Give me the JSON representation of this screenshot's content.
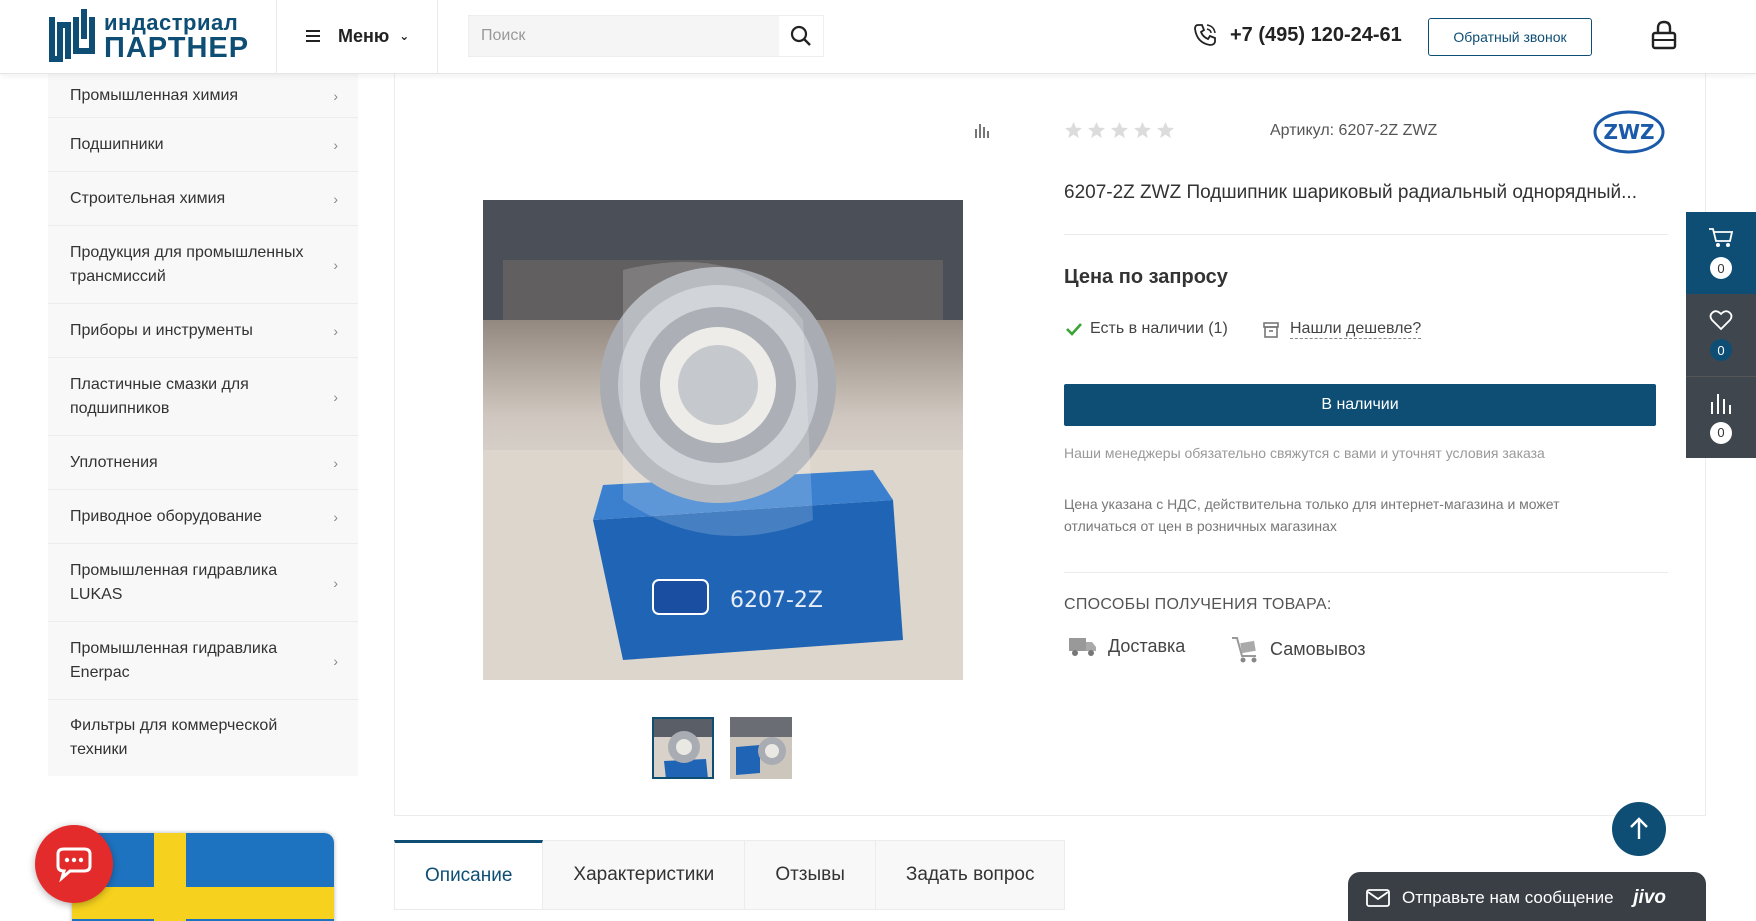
{
  "header": {
    "logo_line1": "индастриал",
    "logo_line2": "ПАРТНЕР",
    "menu_label": "Меню",
    "search_placeholder": "Поиск",
    "phone": "+7 (495) 120-24-61",
    "callback_label": "Обратный звонок"
  },
  "sidebar": {
    "items": [
      {
        "label": "Промышленная химия",
        "has_arrow": true
      },
      {
        "label": "Подшипники",
        "has_arrow": true
      },
      {
        "label": "Строительная химия",
        "has_arrow": true
      },
      {
        "label": "Продукция для промышленных трансмиссий",
        "has_arrow": true
      },
      {
        "label": "Приборы и инструменты",
        "has_arrow": true
      },
      {
        "label": "Пластичные смазки для подшипников",
        "has_arrow": true
      },
      {
        "label": "Уплотнения",
        "has_arrow": true
      },
      {
        "label": "Приводное оборудование",
        "has_arrow": true
      },
      {
        "label": "Промышленная гидравлика LUKAS",
        "has_arrow": true
      },
      {
        "label": "Промышленная гидравлика Enerpac",
        "has_arrow": true
      },
      {
        "label": "Фильтры для коммерческой техники",
        "has_arrow": false
      }
    ]
  },
  "product": {
    "rating": 0,
    "rating_max": 5,
    "sku": "Артикул: 6207-2Z ZWZ",
    "brand": "ZWZ",
    "title": "6207-2Z ZWZ Подшипник шариковый радиальный однорядный...",
    "image_box_text": "6207-2Z",
    "price": "Цена по запросу",
    "stock": "Есть в наличии (1)",
    "cheaper": "Нашли дешевле?",
    "buy_label": "В наличии",
    "note_managers": "Наши менеджеры обязательно свяжутся с вами и уточнят условия заказа",
    "note_price": "Цена указана с НДС, действительна только для интернет-магазина и может отличаться от цен в розничных магазинах",
    "methods_title": "СПОСОБЫ ПОЛУЧЕНИЯ ТОВАРА:",
    "methods": [
      "Доставка",
      "Самовывоз"
    ]
  },
  "right_bar": {
    "cart_count": "0",
    "favorites_count": "0",
    "compare_count": "0"
  },
  "tabs": [
    "Описание",
    "Характеристики",
    "Отзывы",
    "Задать вопрос"
  ],
  "jivo": {
    "label": "Отправьте нам сообщение",
    "brand": "jivo"
  },
  "colors": {
    "brand": "#0e4e75",
    "dark_panel": "#40464e",
    "chat_red": "#e32b2b",
    "stock_check": "#3aa335"
  }
}
